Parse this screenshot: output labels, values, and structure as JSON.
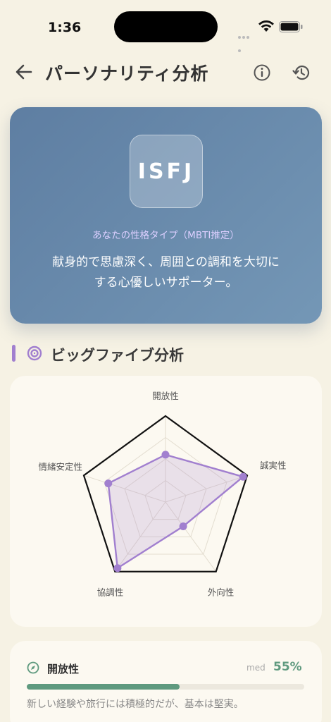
{
  "status": {
    "time": "1:36"
  },
  "header": {
    "title": "パーソナリティ分析"
  },
  "mbti": {
    "code": "ISFJ",
    "caption": "あなたの性格タイプ（MBTI推定）",
    "desc_line1": "献身的で思慮深く、周囲との調和を大切に",
    "desc_line2": "する心優しいサポーター。"
  },
  "section": {
    "title": "ビッグファイブ分析"
  },
  "chart_data": {
    "type": "radar",
    "axes": [
      "開放性",
      "誠実性",
      "外向性",
      "協調性",
      "情緒安定性"
    ],
    "values": [
      0.55,
      0.95,
      0.35,
      0.95,
      0.7
    ],
    "max": 1.0,
    "colors": {
      "fill": "#a17fcf",
      "outline": "#111111"
    }
  },
  "traits": [
    {
      "name": "開放性",
      "level": "med",
      "percent_text": "55%",
      "value": 0.55,
      "desc": "新しい経験や旅行には積極的だが、基本は堅実。"
    }
  ],
  "colors": {
    "accent": "#a17fcf",
    "card_gradient_start": "#5e7ea2",
    "card_gradient_end": "#7497b6",
    "progress": "#5f9a7f",
    "background": "#f6f2e4"
  }
}
